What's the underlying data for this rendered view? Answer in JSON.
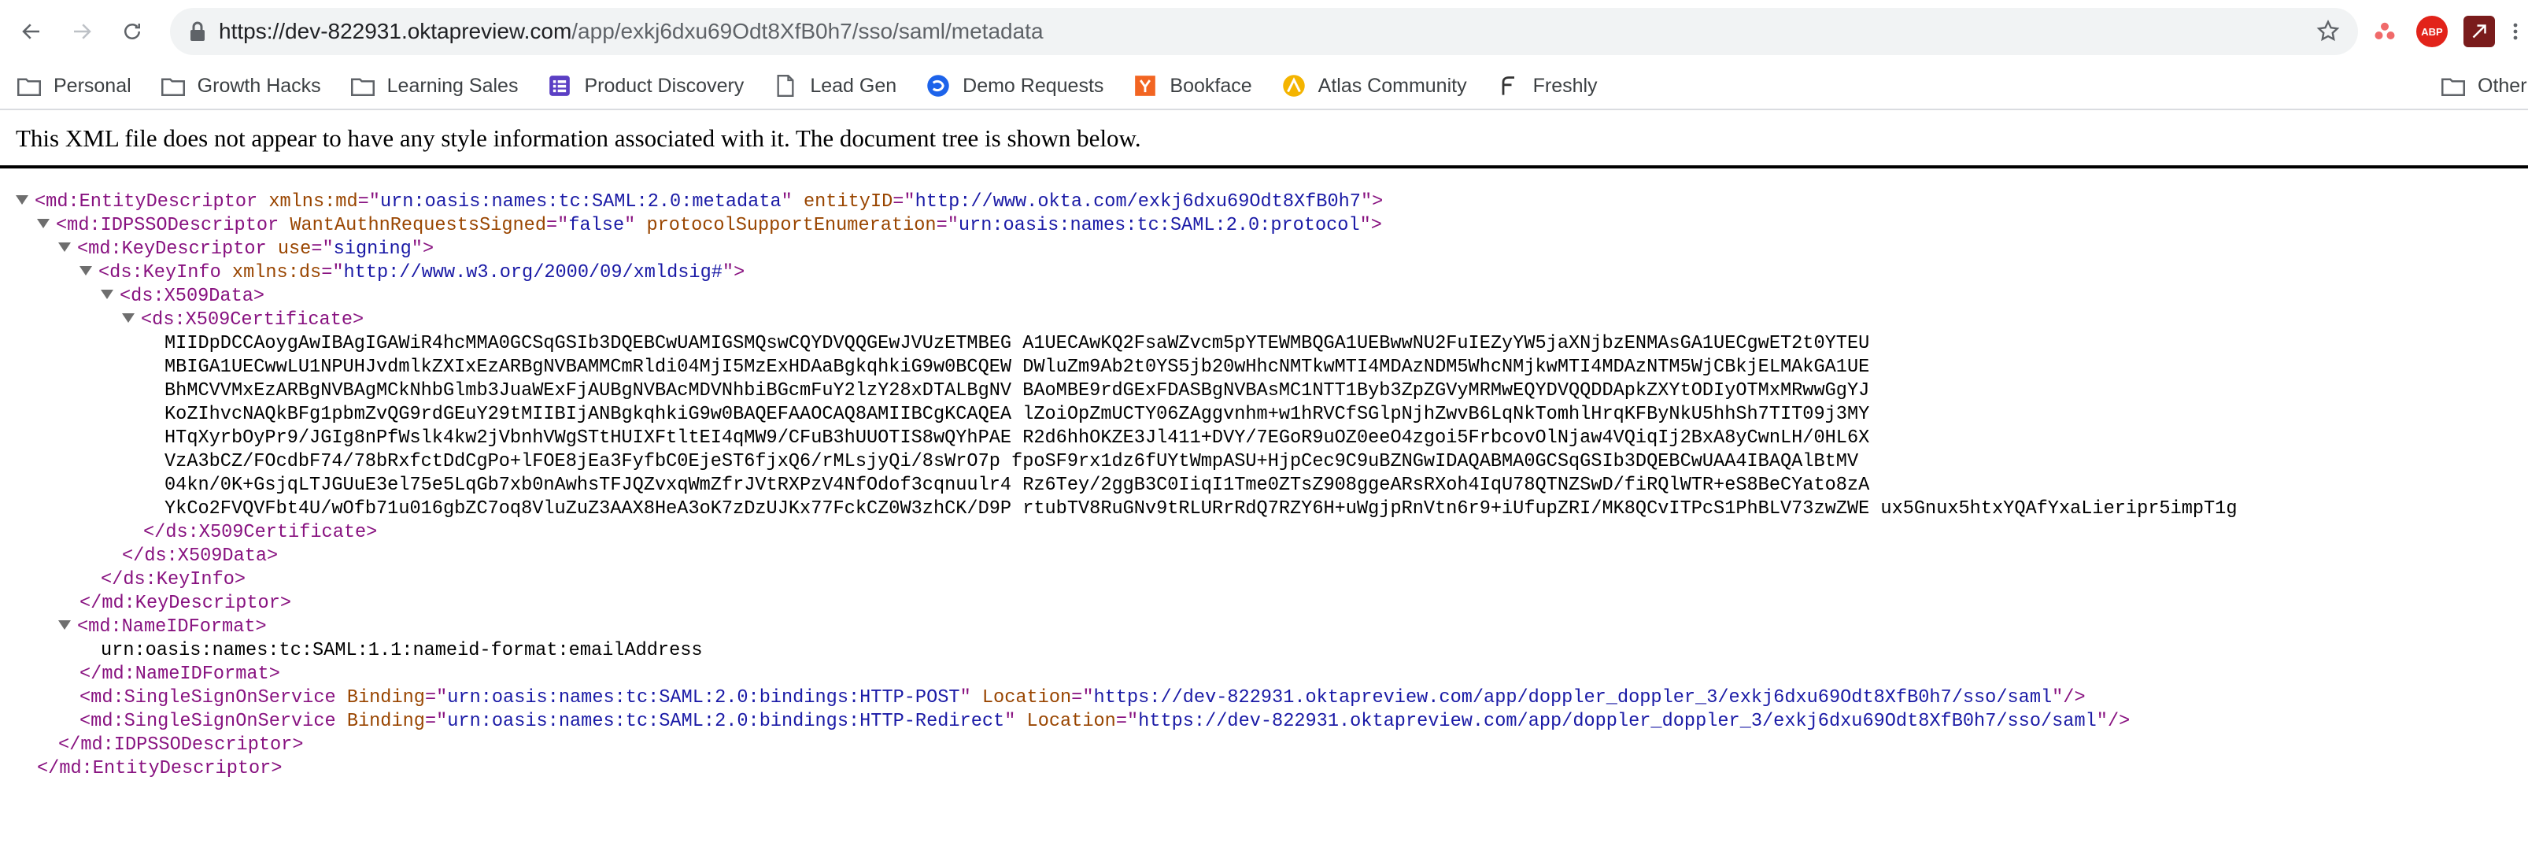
{
  "browser": {
    "url_scheme": "https://",
    "url_host": "dev-822931.oktapreview.com",
    "url_path": "/app/exkj6dxu69Odt8XfB0h7/sso/saml/metadata",
    "abp_label": "ABP"
  },
  "bookmarks": [
    {
      "label": "Personal",
      "icon": "folder-icon"
    },
    {
      "label": "Growth Hacks",
      "icon": "folder-icon"
    },
    {
      "label": "Learning Sales",
      "icon": "folder-icon"
    },
    {
      "label": "Product Discovery",
      "icon": "productboard-icon"
    },
    {
      "label": "Lead Gen",
      "icon": "page-icon"
    },
    {
      "label": "Demo Requests",
      "icon": "drift-icon"
    },
    {
      "label": "Bookface",
      "icon": "yc-icon"
    },
    {
      "label": "Atlas Community",
      "icon": "atlas-icon"
    },
    {
      "label": "Freshly",
      "icon": "freshly-icon"
    }
  ],
  "other_bookmarks": "Other B",
  "xml": {
    "notice": "This XML file does not appear to have any style information associated with it. The document tree is shown below.",
    "lines": [
      {
        "indent": 0,
        "tri": true,
        "parts": [
          [
            "tag",
            "<md:EntityDescriptor"
          ],
          [
            "attr",
            " xmlns:md"
          ],
          [
            "tag",
            "=\""
          ],
          [
            "val",
            "urn:oasis:names:tc:SAML:2.0:metadata"
          ],
          [
            "tag",
            "\""
          ],
          [
            "attr",
            " entityID"
          ],
          [
            "tag",
            "=\""
          ],
          [
            "val",
            "http://www.okta.com/exkj6dxu69Odt8XfB0h7"
          ],
          [
            "tag",
            "\">"
          ]
        ]
      },
      {
        "indent": 1,
        "tri": true,
        "parts": [
          [
            "tag",
            "<md:IDPSSODescriptor"
          ],
          [
            "attr",
            " WantAuthnRequestsSigned"
          ],
          [
            "tag",
            "=\""
          ],
          [
            "val",
            "false"
          ],
          [
            "tag",
            "\""
          ],
          [
            "attr",
            " protocolSupportEnumeration"
          ],
          [
            "tag",
            "=\""
          ],
          [
            "val",
            "urn:oasis:names:tc:SAML:2.0:protocol"
          ],
          [
            "tag",
            "\">"
          ]
        ]
      },
      {
        "indent": 2,
        "tri": true,
        "parts": [
          [
            "tag",
            "<md:KeyDescriptor"
          ],
          [
            "attr",
            " use"
          ],
          [
            "tag",
            "=\""
          ],
          [
            "val",
            "signing"
          ],
          [
            "tag",
            "\">"
          ]
        ]
      },
      {
        "indent": 3,
        "tri": true,
        "parts": [
          [
            "tag",
            "<ds:KeyInfo"
          ],
          [
            "attr",
            " xmlns:ds"
          ],
          [
            "tag",
            "=\""
          ],
          [
            "val",
            "http://www.w3.org/2000/09/xmldsig#"
          ],
          [
            "tag",
            "\">"
          ]
        ]
      },
      {
        "indent": 4,
        "tri": true,
        "parts": [
          [
            "tag",
            "<ds:X509Data>"
          ]
        ]
      },
      {
        "indent": 5,
        "tri": true,
        "parts": [
          [
            "tag",
            "<ds:X509Certificate>"
          ]
        ]
      },
      {
        "indent": 7,
        "tri": false,
        "parts": [
          [
            "txt",
            "MIIDpDCCAoygAwIBAgIGAWiR4hcMMA0GCSqGSIb3DQEBCwUAMIGSMQswCQYDVQQGEwJVUzETMBEG A1UECAwKQ2FsaWZvcm5pYTEWMBQGA1UEBwwNU2FuIEZyYW5jaXNjbzENMAsGA1UECgwET2t0YTEU"
          ]
        ]
      },
      {
        "indent": 7,
        "tri": false,
        "parts": [
          [
            "txt",
            "MBIGA1UECwwLU1NPUHJvdmlkZXIxEzARBgNVBAMMCmRldi04MjI5MzExHDAaBgkqhkiG9w0BCQEW DWluZm9Ab2t0YS5jb20wHhcNMTkwMTI4MDAzNDM5WhcNMjkwMTI4MDAzNTM5WjCBkjELMAkGA1UE"
          ]
        ]
      },
      {
        "indent": 7,
        "tri": false,
        "parts": [
          [
            "txt",
            "BhMCVVMxEzARBgNVBAgMCkNhbGlmb3JuaWExFjAUBgNVBAcMDVNhbiBGcmFuY2lzY28xDTALBgNV BAoMBE9rdGExFDASBgNVBAsMC1NTT1Byb3ZpZGVyMRMwEQYDVQQDDApkZXYtODIyOTMxMRwwGgYJ"
          ]
        ]
      },
      {
        "indent": 7,
        "tri": false,
        "parts": [
          [
            "txt",
            "KoZIhvcNAQkBFg1pbmZvQG9rdGEuY29tMIIBIjANBgkqhkiG9w0BAQEFAAOCAQ8AMIIBCgKCAQEA lZoiOpZmUCTY06ZAggvnhm+w1hRVCfSGlpNjhZwvB6LqNkTomhlHrqKFByNkU5hhSh7TIT09j3MY"
          ]
        ]
      },
      {
        "indent": 7,
        "tri": false,
        "parts": [
          [
            "txt",
            "HTqXyrbOyPr9/JGIg8nPfWslk4kw2jVbnhVWgSTtHUIXFtltEI4qMW9/CFuB3hUUOTIS8wQYhPAE R2d6hhOKZE3Jl411+DVY/7EGoR9uOZ0eeO4zgoi5FrbcovOlNjaw4VQiqIj2BxA8yCwnLH/0HL6X"
          ]
        ]
      },
      {
        "indent": 7,
        "tri": false,
        "parts": [
          [
            "txt",
            "VzA3bCZ/FOcdbF74/78bRxfctDdCgPo+lFOE8jEa3FyfbC0EjeST6fjxQ6/rMLsjyQi/8sWrO7p fpoSF9rx1dz6fUYtWmpASU+HjpCec9C9uBZNGwIDAQABMA0GCSqGSIb3DQEBCwUAA4IBAQAlBtMV"
          ]
        ]
      },
      {
        "indent": 7,
        "tri": false,
        "parts": [
          [
            "txt",
            "04kn/0K+GsjqLTJGUuE3el75e5LqGb7xb0nAwhsTFJQZvxqWmZfrJVtRXPzV4NfOdof3cqnuulr4 Rz6Tey/2ggB3C0IiqI1Tme0ZTsZ908ggeARsRXoh4IqU78QTNZSwD/fiRQlWTR+eS8BeCYato8zA"
          ]
        ]
      },
      {
        "indent": 7,
        "tri": false,
        "parts": [
          [
            "txt",
            "YkCo2FVQVFbt4U/wOfb71u016gbZC7oq8VluZuZ3AAX8HeA3oK7zDzUJKx77FckCZ0W3zhCK/D9P rtubTV8RuGNv9tRLURrRdQ7RZY6H+uWgjpRnVtn6r9+iUfupZRI/MK8QCvITPcS1PhBLV73zwZWE ux5Gnux5htxYQAfYxaLieripr5impT1g"
          ]
        ]
      },
      {
        "indent": 6,
        "tri": false,
        "parts": [
          [
            "tag",
            "</ds:X509Certificate>"
          ]
        ]
      },
      {
        "indent": 5,
        "tri": false,
        "parts": [
          [
            "tag",
            "</ds:X509Data>"
          ]
        ]
      },
      {
        "indent": 4,
        "tri": false,
        "parts": [
          [
            "tag",
            "</ds:KeyInfo>"
          ]
        ]
      },
      {
        "indent": 3,
        "tri": false,
        "parts": [
          [
            "tag",
            "</md:KeyDescriptor>"
          ]
        ]
      },
      {
        "indent": 2,
        "tri": true,
        "parts": [
          [
            "tag",
            "<md:NameIDFormat>"
          ]
        ]
      },
      {
        "indent": 4,
        "tri": false,
        "parts": [
          [
            "txt",
            "urn:oasis:names:tc:SAML:1.1:nameid-format:emailAddress"
          ]
        ]
      },
      {
        "indent": 3,
        "tri": false,
        "parts": [
          [
            "tag",
            "</md:NameIDFormat>"
          ]
        ]
      },
      {
        "indent": 3,
        "tri": false,
        "parts": [
          [
            "tag",
            "<md:SingleSignOnService"
          ],
          [
            "attr",
            " Binding"
          ],
          [
            "tag",
            "=\""
          ],
          [
            "val",
            "urn:oasis:names:tc:SAML:2.0:bindings:HTTP-POST"
          ],
          [
            "tag",
            "\""
          ],
          [
            "attr",
            " Location"
          ],
          [
            "tag",
            "=\""
          ],
          [
            "val",
            "https://dev-822931.oktapreview.com/app/doppler_doppler_3/exkj6dxu69Odt8XfB0h7/sso/saml"
          ],
          [
            "tag",
            "\"/>"
          ]
        ]
      },
      {
        "indent": 3,
        "tri": false,
        "parts": [
          [
            "tag",
            "<md:SingleSignOnService"
          ],
          [
            "attr",
            " Binding"
          ],
          [
            "tag",
            "=\""
          ],
          [
            "val",
            "urn:oasis:names:tc:SAML:2.0:bindings:HTTP-Redirect"
          ],
          [
            "tag",
            "\""
          ],
          [
            "attr",
            " Location"
          ],
          [
            "tag",
            "=\""
          ],
          [
            "val",
            "https://dev-822931.oktapreview.com/app/doppler_doppler_3/exkj6dxu69Odt8XfB0h7/sso/saml"
          ],
          [
            "tag",
            "\"/>"
          ]
        ]
      },
      {
        "indent": 2,
        "tri": false,
        "parts": [
          [
            "tag",
            "</md:IDPSSODescriptor>"
          ]
        ]
      },
      {
        "indent": 1,
        "tri": false,
        "parts": [
          [
            "tag",
            "</md:EntityDescriptor>"
          ]
        ]
      }
    ]
  }
}
